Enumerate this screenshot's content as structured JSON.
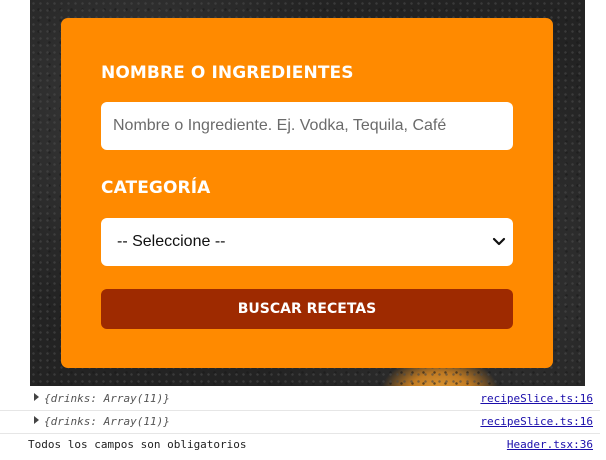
{
  "form": {
    "name_label": "NOMBRE O INGREDIENTES",
    "name_placeholder": "Nombre o Ingrediente. Ej. Vodka, Tequila, Café",
    "category_label": "CATEGORÍA",
    "category_selected": "-- Seleccione --",
    "search_button": "BUSCAR RECETAS"
  },
  "console": {
    "lines": [
      {
        "text": "{drinks: Array(11)}",
        "source": "recipeSlice.ts:16"
      },
      {
        "text": "{drinks: Array(11)}",
        "source": "recipeSlice.ts:16"
      },
      {
        "text": "Todos los campos son obligatorios",
        "source": "Header.tsx:36"
      }
    ]
  },
  "colors": {
    "card": "#ff8a00",
    "button": "#9e2a00",
    "link": "#1a0dab"
  },
  "icons": {
    "select": "chevron-down-icon",
    "console_expand": "triangle-right-icon"
  }
}
